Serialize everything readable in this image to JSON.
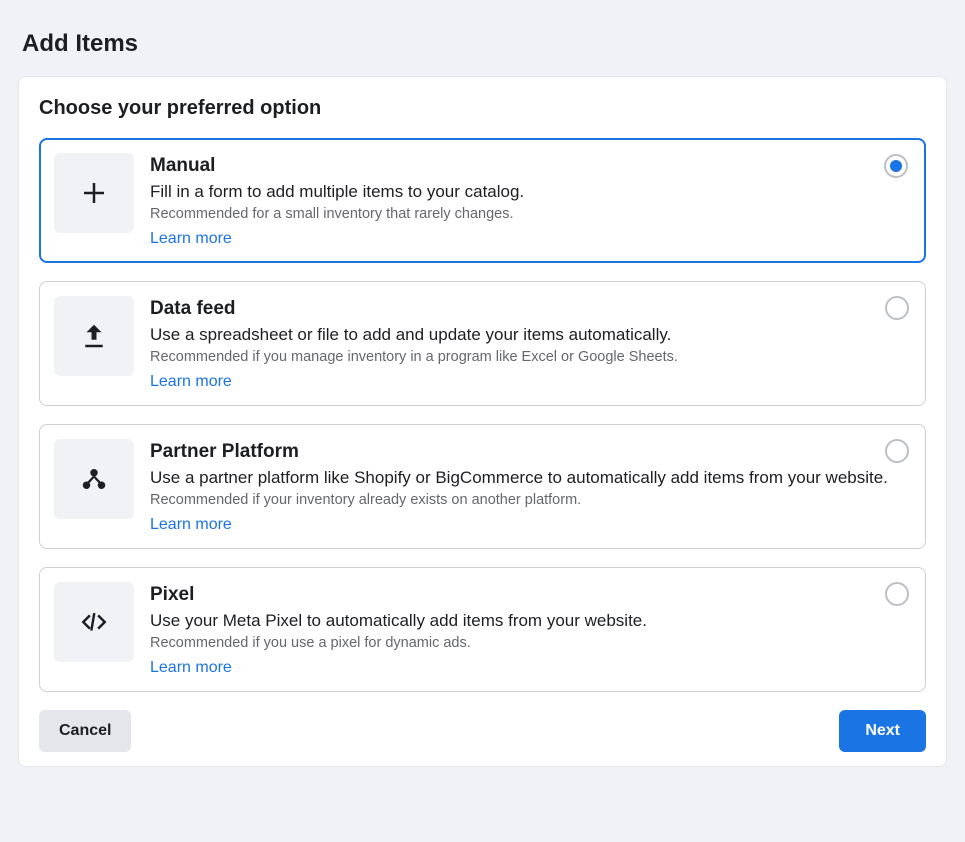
{
  "page": {
    "title": "Add Items",
    "subtitle": "Choose your preferred option"
  },
  "options": [
    {
      "title": "Manual",
      "description": "Fill in a form to add multiple items to your catalog.",
      "recommendation": "Recommended for a small inventory that rarely changes.",
      "learn_more": "Learn more",
      "icon": "plus-icon",
      "selected": true
    },
    {
      "title": "Data feed",
      "description": "Use a spreadsheet or file to add and update your items automatically.",
      "recommendation": "Recommended if you manage inventory in a program like Excel or Google Sheets.",
      "learn_more": "Learn more",
      "icon": "upload-icon",
      "selected": false
    },
    {
      "title": "Partner Platform",
      "description": "Use a partner platform like Shopify or BigCommerce to automatically add items from your website.",
      "recommendation": "Recommended if your inventory already exists on another platform.",
      "learn_more": "Learn more",
      "icon": "partner-icon",
      "selected": false
    },
    {
      "title": "Pixel",
      "description": "Use your Meta Pixel to automatically add items from your website.",
      "recommendation": "Recommended if you use a pixel for dynamic ads.",
      "learn_more": "Learn more",
      "icon": "code-icon",
      "selected": false
    }
  ],
  "footer": {
    "cancel": "Cancel",
    "next": "Next"
  }
}
